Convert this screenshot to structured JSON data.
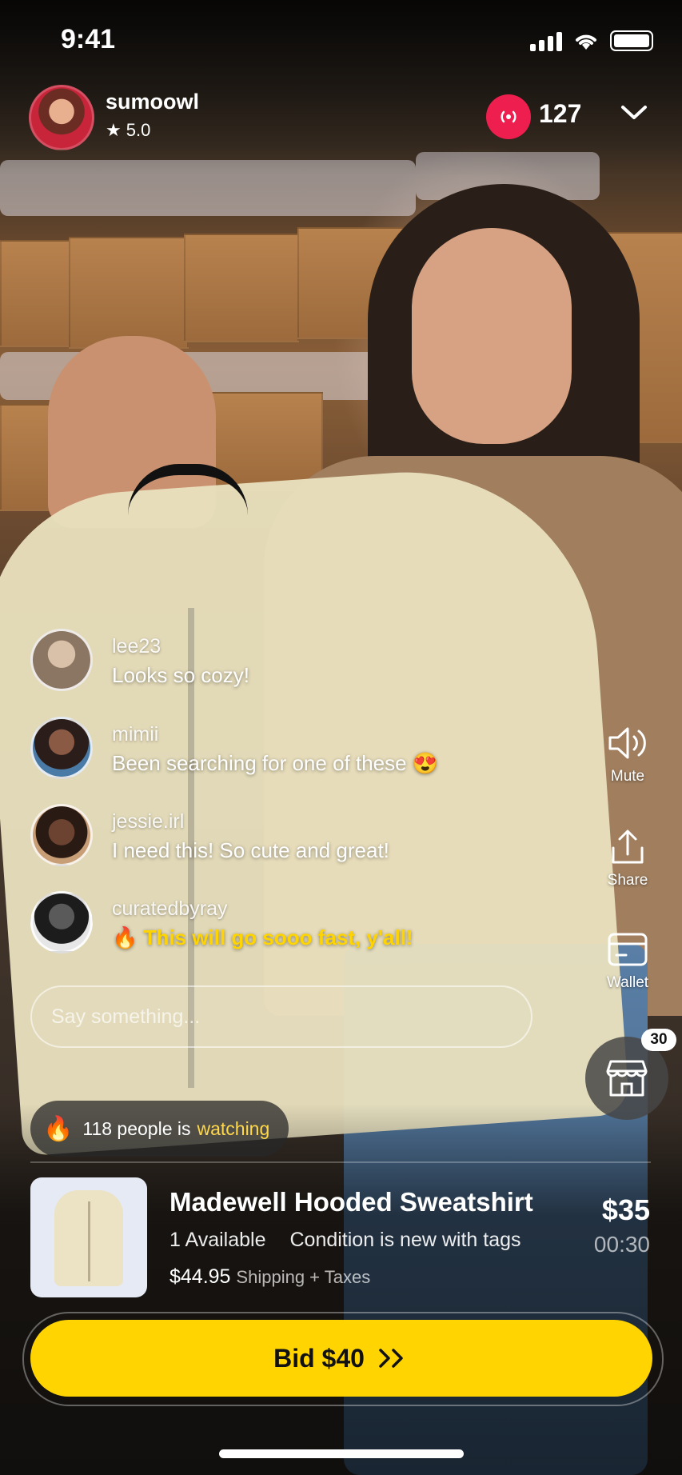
{
  "status_bar": {
    "time": "9:41"
  },
  "host": {
    "name": "sumoowl",
    "rating": "5.0"
  },
  "live": {
    "viewer_count": "127"
  },
  "chat": [
    {
      "user": "lee23",
      "text": "Looks so cozy!",
      "avatar_color": "#b7a493",
      "highlight": false
    },
    {
      "user": "mimii",
      "text": "Been searching for one of these 😍",
      "avatar_color": "#3a2a26",
      "highlight": false
    },
    {
      "user": "jessie.irl",
      "text": "I need this! So cute and great!",
      "avatar_color": "#4d3326",
      "highlight": false
    },
    {
      "user": "curatedbyray",
      "text": "🔥 This will go sooo fast, y'all!",
      "avatar_color": "#2b2b2b",
      "highlight": true
    }
  ],
  "input": {
    "placeholder": "Say something..."
  },
  "watching": {
    "icon": "🔥",
    "prefix": "118 people is",
    "accent": "watching"
  },
  "side_actions": {
    "mute": "Mute",
    "share": "Share",
    "wallet": "Wallet",
    "store_count": "30"
  },
  "product": {
    "title": "Madewell Hooded Sweatshirt",
    "available": "1 Available",
    "condition": "Condition is new with tags",
    "shipping_price": "$44.95",
    "shipping_label": "Shipping + Taxes",
    "price": "$35",
    "timer": "00:30"
  },
  "bid": {
    "label": "Bid $40"
  },
  "colors": {
    "accent_yellow": "#ffd400",
    "live_red": "#ee1f4e"
  }
}
